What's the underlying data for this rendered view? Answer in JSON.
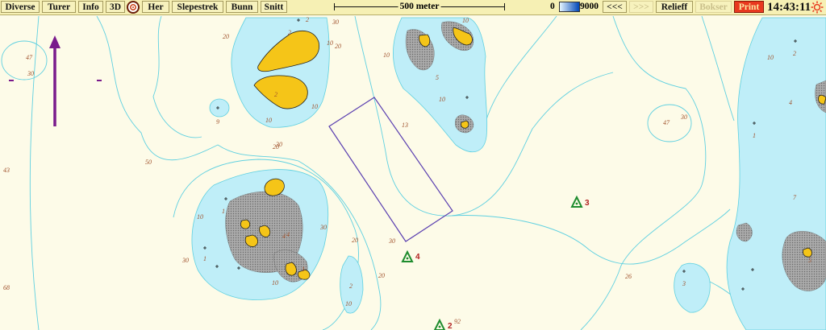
{
  "toolbar": {
    "buttons": [
      "Diverse",
      "Turer",
      "Info",
      "3D",
      "Her",
      "Slepestrek",
      "Bunn",
      "Snitt",
      "<<<",
      ">>>",
      "Relieff",
      "Bokser",
      "Print"
    ],
    "scale_label": "500 meter",
    "depth_min": "0",
    "depth_max": "9000",
    "clock": "14:43:11"
  },
  "map": {
    "depth_labels": [
      "20",
      "2",
      "2",
      "30",
      "10",
      "20",
      "2",
      "47",
      "10",
      "30",
      "10",
      "9",
      "5",
      "10",
      "13",
      "10",
      "10",
      "30",
      "50",
      "30",
      "43",
      "47",
      "10",
      "30",
      "1",
      "4",
      "10",
      "20",
      "20",
      "2",
      "1",
      "4",
      "1",
      "30",
      "30",
      "20",
      "68",
      "10",
      "26",
      "2",
      "10",
      "3",
      "4",
      "1",
      "7",
      "5"
    ],
    "markers": [
      {
        "label": "3",
        "color": "#1e8c2e"
      },
      {
        "label": "4",
        "color": "#1e8c2e"
      },
      {
        "label": "2",
        "color": "#1e8c2e"
      }
    ],
    "extra_label": "92",
    "colors": {
      "land": "#f5c518",
      "shallow": "#bfeef8",
      "dry": "#9a9a9a",
      "contour": "#5fd0e0",
      "track": "#5a3fb0",
      "arrow": "#7a1a8c"
    }
  }
}
